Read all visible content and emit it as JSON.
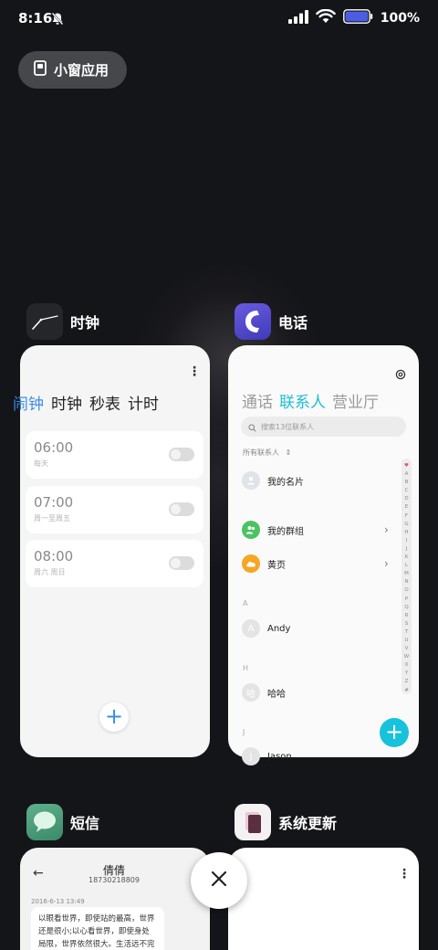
{
  "status_bar": {
    "time": "8:16",
    "battery_percent": "100%",
    "battery_level": 1.0
  },
  "small_window": {
    "label": "小窗应用"
  },
  "clock_app": {
    "name": "时钟",
    "tabs": [
      "闹钟",
      "时钟",
      "秒表",
      "计时"
    ],
    "active_tab": "闹钟",
    "alarms": [
      {
        "time": "06:00",
        "repeat": "每天",
        "enabled": false
      },
      {
        "time": "07:00",
        "repeat": "周一至周五",
        "enabled": false
      },
      {
        "time": "08:00",
        "repeat": "周六 周日",
        "enabled": false
      }
    ],
    "add_label": "+",
    "accent": "#3a8ee6"
  },
  "phone_app": {
    "name": "电话",
    "tabs": [
      "通话",
      "联系人",
      "营业厅"
    ],
    "active_tab": "联系人",
    "search_placeholder": "搜索13位联系人",
    "all_contacts_label": "所有联系人",
    "my_card": "我的名片",
    "my_groups": "我的群组",
    "yellow_pages": "黄页",
    "sections": [
      {
        "letter": "A",
        "contact": "Andy",
        "avatar": "A"
      },
      {
        "letter": "H",
        "contact": "哈哈",
        "avatar": "哈"
      },
      {
        "letter": "J",
        "contact": "Jason",
        "avatar": "J"
      }
    ],
    "alphabet": [
      "♥",
      "A",
      "B",
      "C",
      "D",
      "E",
      "F",
      "G",
      "H",
      "I",
      "J",
      "K",
      "L",
      "M",
      "N",
      "O",
      "P",
      "Q",
      "R",
      "S",
      "T",
      "U",
      "V",
      "W",
      "X",
      "Y",
      "Z",
      "#"
    ],
    "add_label": "+",
    "accent": "#17c2dc"
  },
  "sms_app": {
    "name": "短信",
    "contact_name": "倩倩",
    "contact_number": "18730218809",
    "date": "2016-6-13 13:49",
    "message_lines": [
      "以眼看世界，即使站的最高，世界",
      "还是很小;以心看世界，即使身处",
      "局限，世界依然很大。生活远不完"
    ]
  },
  "update_app": {
    "name": "系统更新"
  },
  "close_button_label": "×"
}
